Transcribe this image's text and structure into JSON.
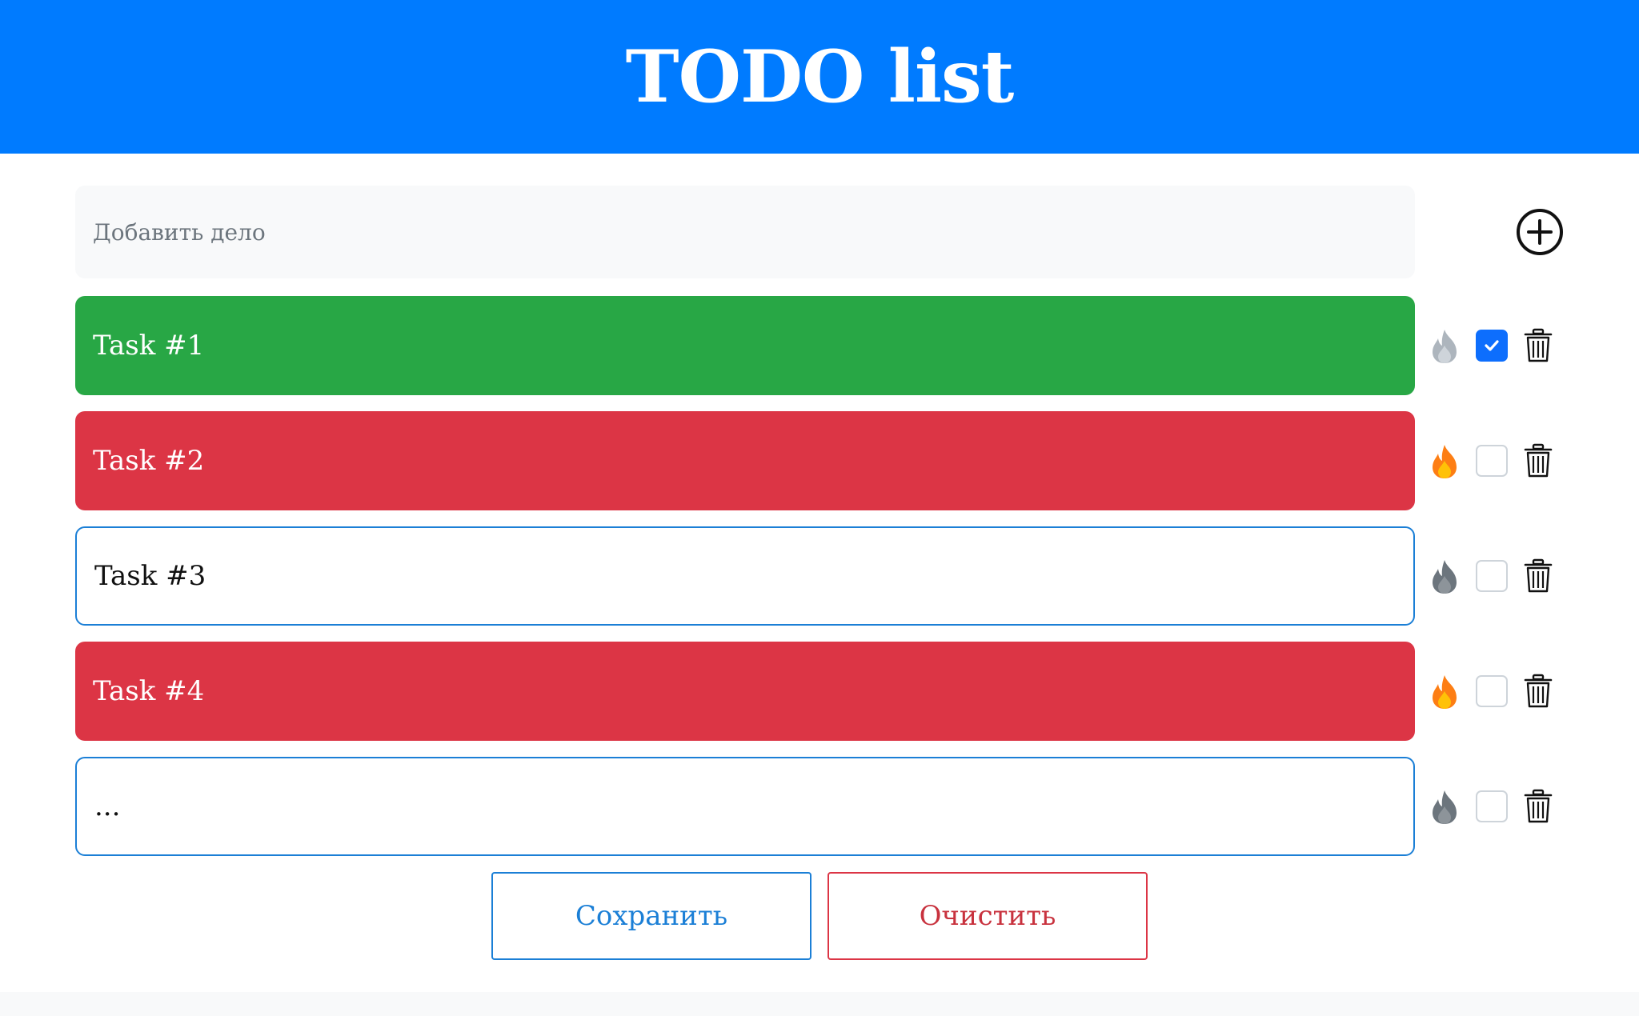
{
  "header": {
    "title": "TODO list"
  },
  "add": {
    "placeholder": "Добавить дело",
    "add_icon": "plus-circle-icon"
  },
  "tasks": [
    {
      "text": "Task #1",
      "state": "done",
      "priority": false,
      "checked": true
    },
    {
      "text": "Task #2",
      "state": "hot",
      "priority": true,
      "checked": false
    },
    {
      "text": "Task #3",
      "state": "plain",
      "priority": false,
      "checked": false
    },
    {
      "text": "Task #4",
      "state": "hot",
      "priority": true,
      "checked": false
    },
    {
      "text": "...",
      "state": "plain",
      "priority": false,
      "checked": false
    }
  ],
  "buttons": {
    "save_label": "Сохранить",
    "clear_label": "Очистить"
  },
  "colors": {
    "header": "#007bff",
    "done": "#28a745",
    "hot": "#dc3545",
    "outline": "#1b7fd6",
    "checkbox_checked": "#0d6efd",
    "flame_active": "#fd7e14",
    "flame_inactive_light": "#adb5bd",
    "flame_inactive_dark": "#6c757d"
  }
}
